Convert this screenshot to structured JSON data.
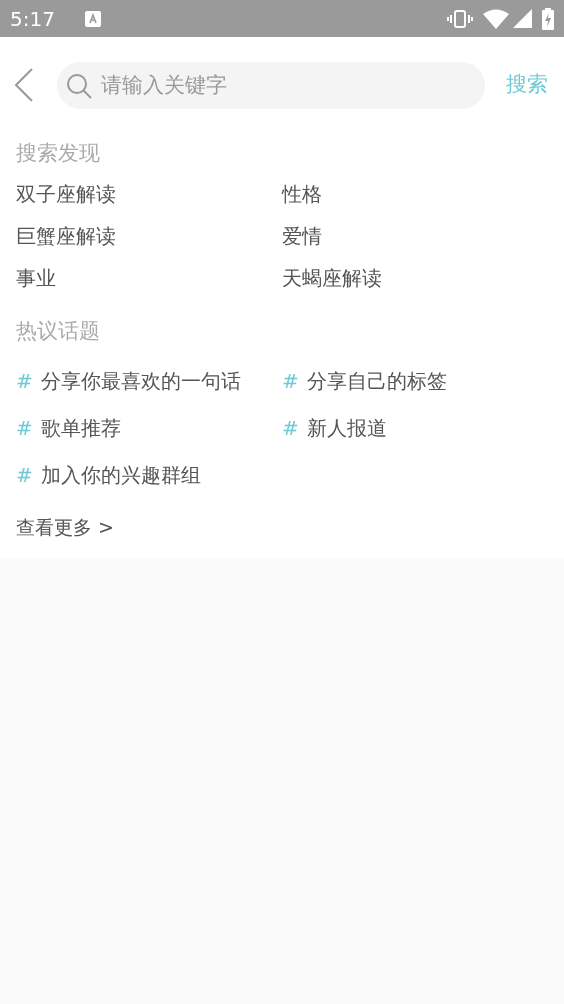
{
  "status_bar": {
    "time": "5:17"
  },
  "search": {
    "placeholder": "请输入关键字",
    "button": "搜索"
  },
  "discover": {
    "title": "搜索发现",
    "items": [
      "双子座解读",
      "性格",
      "巨蟹座解读",
      "爱情",
      "事业",
      "天蝎座解读"
    ]
  },
  "topics": {
    "title": "热议话题",
    "items": [
      {
        "mark": "#",
        "label": "分享你最喜欢的一句话"
      },
      {
        "mark": "#",
        "label": "分享自己的标签"
      },
      {
        "mark": "#",
        "label": "歌单推荐"
      },
      {
        "mark": "#",
        "label": "新人报道"
      },
      {
        "mark": "#",
        "label": "加入你的兴趣群组"
      }
    ],
    "more": "查看更多 >"
  }
}
